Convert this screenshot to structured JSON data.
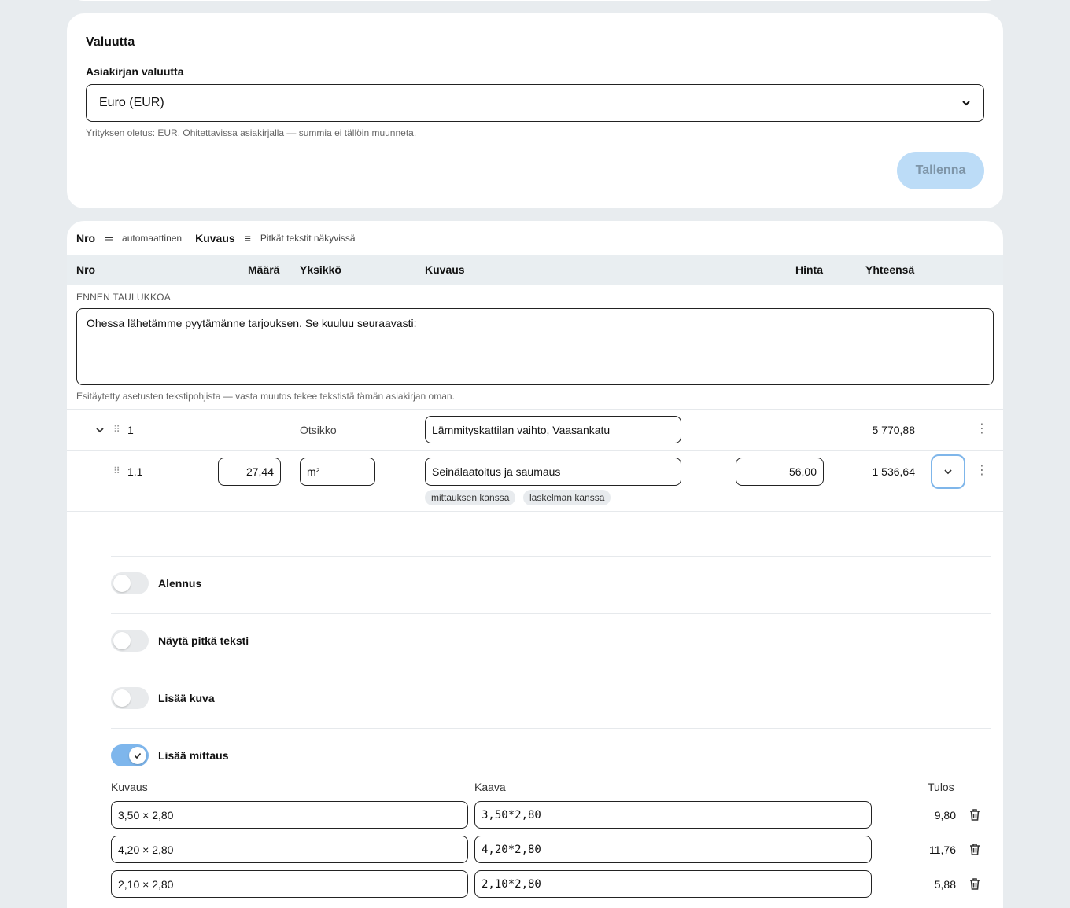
{
  "currency": {
    "title": "Valuutta",
    "field_label": "Asiakirjan valuutta",
    "selected": "Euro (EUR)",
    "hint": "Yrityksen oletus: EUR. Ohitettavissa asiakirjalla — summia ei tällöin muunneta.",
    "save_label": "Tallenna"
  },
  "modes": {
    "nro_label": "Nro",
    "nro_value": "automaattinen",
    "kuvaus_label": "Kuvaus",
    "kuvaus_value": "Pitkät tekstit näkyvissä"
  },
  "table": {
    "headers": {
      "nro": "Nro",
      "maara": "Määrä",
      "yksikko": "Yksikkö",
      "kuvaus": "Kuvaus",
      "hinta": "Hinta",
      "yhteensa": "Yhteensä"
    },
    "pre_label": "ENNEN TAULUKKOA",
    "pre_text": "Ohessa lähetämme pyytämänne tarjouksen. Se kuuluu seuraavasti:",
    "pre_hint": "Esitäytetty asetusten tekstipohjista — vasta muutos tekee tekstistä tämän asiakirjan oman.",
    "heading_row": {
      "nro": "1",
      "unit": "Otsikko",
      "description": "Lämmityskattilan vaihto, Vaasankatu",
      "total": "5 770,88"
    },
    "item_row": {
      "nro": "1.1",
      "quantity": "27,44",
      "unit": "m²",
      "description": "Seinälaatoitus ja saumaus",
      "price": "56,00",
      "total": "1 536,64",
      "tags": [
        "mittauksen kanssa",
        "laskelman kanssa"
      ]
    }
  },
  "options": {
    "discount": "Alennus",
    "long_text": "Näytä pitkä teksti",
    "add_image": "Lisää kuva",
    "add_measure": "Lisää mittaus",
    "discount_on": false,
    "long_text_on": false,
    "add_image_on": false,
    "add_measure_on": true
  },
  "measurements": {
    "headers": {
      "description": "Kuvaus",
      "formula": "Kaava",
      "result": "Tulos"
    },
    "rows": [
      {
        "description": "3,50 × 2,80",
        "formula": "3,50*2,80",
        "result": "9,80"
      },
      {
        "description": "4,20 × 2,80",
        "formula": "4,20*2,80",
        "result": "11,76"
      },
      {
        "description": "2,10 × 2,80",
        "formula": "2,10*2,80",
        "result": "5,88"
      }
    ]
  }
}
